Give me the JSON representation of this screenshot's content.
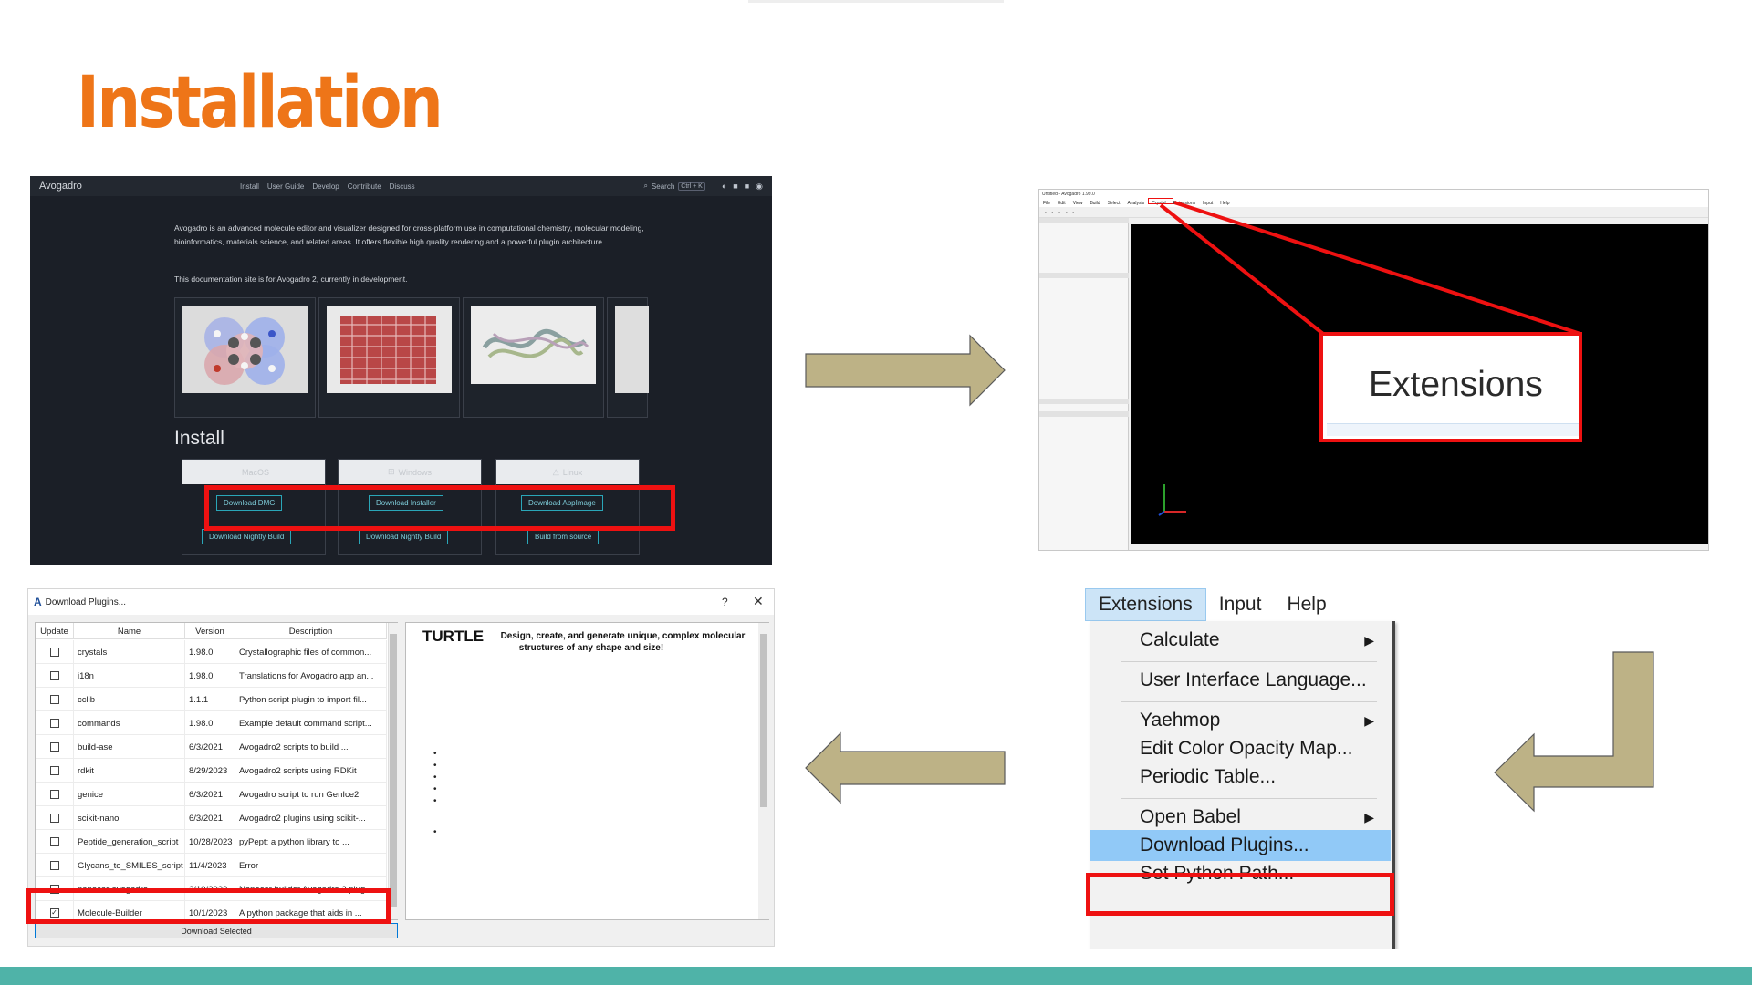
{
  "slide": {
    "title": "Installation"
  },
  "website": {
    "brand": "Avogadro",
    "nav": [
      "Install",
      "User Guide",
      "Develop",
      "Contribute",
      "Discuss"
    ],
    "search_label": "Search",
    "search_kbd": "Ctrl + K",
    "intro": "Avogadro is an advanced molecule editor and visualizer designed for cross-platform use in computational chemistry, molecular modeling, bioinformatics, materials science, and related areas. It offers flexible high quality rendering and a powerful plugin architecture.",
    "dev_note": "This documentation site is for Avogadro 2, currently in development.",
    "install_heading": "Install",
    "platforms": [
      {
        "name": "MacOS",
        "primary": "Download DMG",
        "secondary": "Download Nightly Build"
      },
      {
        "name": "Windows",
        "primary": "Download Installer",
        "secondary": "Download Nightly Build"
      },
      {
        "name": "Linux",
        "primary": "Download AppImage",
        "secondary": "Build from source"
      }
    ]
  },
  "app": {
    "window_title": "Untitled - Avogadro 1.99.0",
    "menu": [
      "File",
      "Edit",
      "View",
      "Build",
      "Select",
      "Analysis",
      "Crystal",
      "Extensions",
      "Input",
      "Help"
    ],
    "callout_label": "Extensions"
  },
  "menu": {
    "bar": [
      "Extensions",
      "Input",
      "Help"
    ],
    "items": [
      {
        "label": "Calculate",
        "submenu": true
      },
      {
        "label": "User Interface Language...",
        "submenu": false
      },
      {
        "label": "Yaehmop",
        "submenu": true
      },
      {
        "label": "Edit Color Opacity Map...",
        "submenu": false
      },
      {
        "label": "Periodic Table...",
        "submenu": false
      },
      {
        "label": "Open Babel",
        "submenu": true
      },
      {
        "label": "Download Plugins...",
        "submenu": false,
        "highlighted": true
      },
      {
        "label": "Set Python Path...",
        "submenu": false
      }
    ]
  },
  "dialog": {
    "title": "Download Plugins...",
    "help": "?",
    "close": "✕",
    "columns": [
      "Update",
      "Name",
      "Version",
      "Description"
    ],
    "rows": [
      {
        "checked": false,
        "name": "crystals",
        "version": "1.98.0",
        "description": "Crystallographic files of common..."
      },
      {
        "checked": false,
        "name": "i18n",
        "version": "1.98.0",
        "description": "Translations for Avogadro app an..."
      },
      {
        "checked": false,
        "name": "cclib",
        "version": "1.1.1",
        "description": "Python script plugin to import fil..."
      },
      {
        "checked": false,
        "name": "commands",
        "version": "1.98.0",
        "description": "Example default command script..."
      },
      {
        "checked": false,
        "name": "build-ase",
        "version": "6/3/2021",
        "description": "Avogadro2 scripts to build ..."
      },
      {
        "checked": false,
        "name": "rdkit",
        "version": "8/29/2023",
        "description": "Avogadro2 scripts using RDKit"
      },
      {
        "checked": false,
        "name": "genice",
        "version": "6/3/2021",
        "description": "Avogadro script to run GenIce2"
      },
      {
        "checked": false,
        "name": "scikit-nano",
        "version": "6/3/2021",
        "description": "Avogadro2 plugins using scikit-..."
      },
      {
        "checked": false,
        "name": "Peptide_generation_script",
        "version": "10/28/2023",
        "description": "pyPept: a python library to ..."
      },
      {
        "checked": false,
        "name": "Glycans_to_SMILES_script",
        "version": "11/4/2023",
        "description": "Error"
      },
      {
        "checked": false,
        "name": "nanocar-avogadro",
        "version": "2/19/2023",
        "description": "Nanocar builder Avogadro 2 plug..."
      },
      {
        "checked": true,
        "name": "Molecule-Builder",
        "version": "10/1/2023",
        "description": "A python package that aids in ..."
      }
    ],
    "download_button": "Download Selected",
    "desc_title": "TURTLE",
    "desc_body": "Design, create, and generate unique, complex molecular structures of any shape and size!"
  },
  "colors": {
    "title": "#ee7518",
    "highlight": "#ee1111",
    "arrow": "#bdb286",
    "band": "#4fb3a8"
  }
}
